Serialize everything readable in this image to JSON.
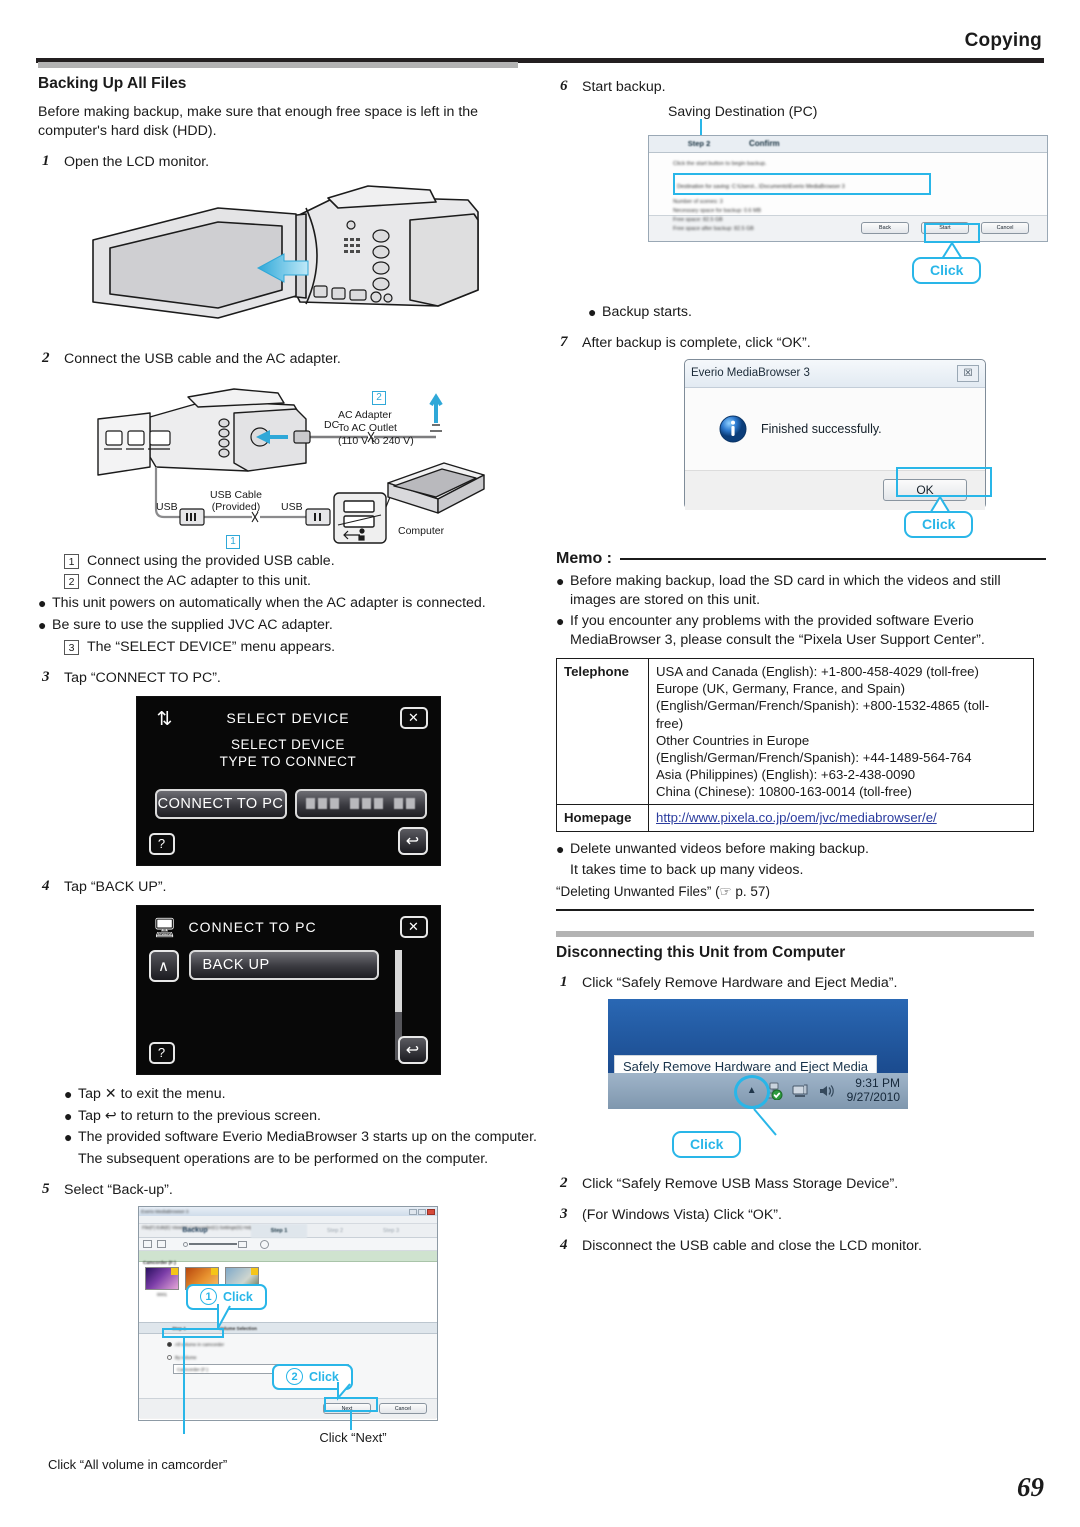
{
  "header": {
    "title": "Copying"
  },
  "page_number": "69",
  "left": {
    "section_title": "Backing Up All Files",
    "intro": "Before making backup, make sure that enough free space is left in the computer's hard disk (HDD).",
    "step1": {
      "num": "1",
      "text": "Open the LCD monitor."
    },
    "step2": {
      "num": "2",
      "text": "Connect the USB cable and the AC adapter."
    },
    "diagram2": {
      "callout_ac": "AC Adapter\nTo AC Outlet\n(110 V to 240 V)",
      "ac_line1": "AC Adapter",
      "ac_line2": "To AC Outlet",
      "ac_line3": "(110 V to 240 V)",
      "dc_label": "DC",
      "usb_left": "USB",
      "usb_right": "USB",
      "usb_cable_l1": "USB Cable",
      "usb_cable_l2": "(Provided)",
      "computer": "Computer",
      "badge1": "1",
      "badge2": "2"
    },
    "sub2": [
      {
        "n": "1",
        "t": "Connect using the provided USB cable."
      },
      {
        "n": "2",
        "t": "Connect the AC adapter to this unit."
      }
    ],
    "bullets2": [
      "This unit powers on automatically when the AC adapter is connected.",
      "Be sure to use the supplied JVC AC adapter."
    ],
    "sub2b": [
      {
        "n": "3",
        "t": "The “SELECT DEVICE” menu appears."
      }
    ],
    "step3": {
      "num": "3",
      "text": "Tap “CONNECT TO PC”."
    },
    "lcd_select_device": {
      "icon": "connect-icon",
      "title": "SELECT DEVICE",
      "sub_line1": "SELECT DEVICE",
      "sub_line2": "TYPE TO CONNECT",
      "button_primary": "CONNECT TO PC",
      "button_secondary_blurred": "",
      "close": "✕",
      "help": "?",
      "back": "↩"
    },
    "step4": {
      "num": "4",
      "text": "Tap “BACK UP”."
    },
    "lcd_connect_to_pc": {
      "icon": "monitor-icon",
      "title": "CONNECT TO PC",
      "button_primary": "BACK UP",
      "close": "✕",
      "help": "?",
      "back": "↩",
      "up": "∧"
    },
    "bullets4": [
      "Tap ✕ to exit the menu.",
      "Tap ↩ to return to the previous screen.",
      "The provided software Everio MediaBrowser 3 starts up on the computer."
    ],
    "bullets4_extra": "The subsequent operations are to be performed on the computer.",
    "step5": {
      "num": "5",
      "text": "Select “Back-up”."
    },
    "mediabrowser": {
      "window_title": "Everio MediaBrowser 3",
      "menu": "File(F)  Edit(E)  View(V)  Camcorder(C)  Settings(S)  Help(H)",
      "tab_backup": "Backup",
      "steps": [
        "Step 1",
        "Step 2",
        "Step 3"
      ],
      "panel_label": "Camcorder (F:)",
      "step_bar_label": "Step 1",
      "step_bar_title": "Volume Selection",
      "radio1": "All volume in camcorder",
      "radio2": "By volume",
      "dropdown_value": "Camcorder (F:)",
      "btn_next": "Next",
      "btn_cancel": "Cancel",
      "callout1_num": "1",
      "callout1_text": "Click",
      "callout2_num": "2",
      "callout2_text": "Click",
      "caption_next": "Click “Next”",
      "caption_allvol": "Click “All volume in camcorder”"
    }
  },
  "right": {
    "step6": {
      "num": "6",
      "text": "Start backup."
    },
    "saving_destination_label": "Saving Destination (PC)",
    "confirm_window": {
      "tab_step": "Step 2",
      "tab_confirm": "Confirm",
      "line_intro": "Click the start button to begin backup.",
      "line_dest": "Destination for saving: C:\\Users\\...\\Documents\\Everio MediaBrowser 3",
      "line_2": "Number of scenes: 3",
      "line_3": "Necessary space for backup: 0.6 MB",
      "line_4": "Free space: 82.5 GB",
      "line_5": "Free space after backup: 82.5 GB",
      "btn_back": "Back",
      "btn_start": "Start",
      "btn_cancel": "Cancel",
      "callout": "Click"
    },
    "bullet_backup_starts": "Backup starts.",
    "step7": {
      "num": "7",
      "text": "After backup is complete, click “OK”."
    },
    "finished_dialog": {
      "title": "Everio MediaBrowser 3",
      "message": "Finished successfully.",
      "ok": "OK",
      "close": "☒",
      "callout": "Click"
    },
    "memo": {
      "heading": "Memo :",
      "bullets": [
        "Before making backup, load the SD card in which the videos and still images are stored on this unit.",
        "If you encounter any problems with the provided software Everio MediaBrowser 3, please consult the “Pixela User Support Center”."
      ]
    },
    "support_table": {
      "telephone_key": "Telephone",
      "telephone_value": "USA and Canada (English): +1-800-458-4029 (toll-free)\nEurope (UK, Germany, France, and Spain)\n(English/German/French/Spanish): +800-1532-4865 (toll-free)\nOther Countries in Europe\n(English/German/French/Spanish): +44-1489-564-764\nAsia (Philippines) (English): +63-2-438-0090\nChina (Chinese): 10800-163-0014 (toll-free)",
      "telephone_lines": [
        "USA and Canada (English): +1-800-458-4029 (toll-free)",
        "Europe (UK, Germany, France, and Spain)",
        "(English/German/French/Spanish): +800-1532-4865 (toll-",
        "free)",
        "Other Countries in Europe",
        "(English/German/French/Spanish): +44-1489-564-764",
        "Asia (Philippines) (English): +63-2-438-0090",
        "China (Chinese): 10800-163-0014 (toll-free)"
      ],
      "homepage_key": "Homepage",
      "homepage_value": "http://www.pixela.co.jp/oem/jvc/mediabrowser/e/"
    },
    "after_table_bullets": [
      "Delete unwanted videos before making backup.",
      "It takes time to back up many videos."
    ],
    "reference": "“Deleting Unwanted Files” (☞ p. 57)",
    "section2_title": "Disconnecting this Unit from Computer",
    "d_step1": {
      "num": "1",
      "text": "Click “Safely Remove Hardware and Eject Media”."
    },
    "tray": {
      "tooltip": "Safely Remove Hardware and Eject Media",
      "time": "9:31 PM",
      "date": "9/27/2010",
      "callout": "Click"
    },
    "d_steps": [
      {
        "num": "2",
        "text": "Click “Safely Remove USB Mass Storage Device”."
      },
      {
        "num": "3",
        "text": "(For Windows Vista) Click “OK”."
      },
      {
        "num": "4",
        "text": "Disconnect the USB cable and close the LCD monitor."
      }
    ]
  },
  "colors": {
    "accent_cyan": "#29b6e8",
    "rule_dark": "#231f20",
    "rule_gray": "#b3b3b3",
    "link": "#2a3b9e"
  }
}
